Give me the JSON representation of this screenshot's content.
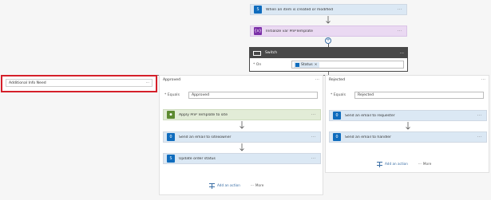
{
  "trigger": {
    "label": "When an item is created or modified"
  },
  "init_var": {
    "label": "Initialize var PnPTemplate",
    "icon_text": "{x}"
  },
  "switch_block": {
    "title": "Switch",
    "on_label": "* On",
    "on_token": "Status",
    "token_remove": "×"
  },
  "cases": {
    "additional": {
      "title": "Additional Info Need"
    },
    "approved": {
      "title": "Approved",
      "equals_label": "* Equals",
      "equals_value": "Approved",
      "steps": [
        "Apply PnP Template to site",
        "Send an email to sitexowner",
        "Update order status"
      ],
      "add_action": "Add an action",
      "more": "More"
    },
    "rejected": {
      "title": "Rejected",
      "equals_label": "* Equals",
      "equals_value": "Rejected",
      "steps": [
        "Send an email to requester",
        "Send an email to handler"
      ],
      "add_action": "Add an action",
      "more": "More"
    }
  },
  "menu_dots": "···",
  "more_dots": "···",
  "colors": {
    "trigger_bg": "#dbe8f4",
    "trigger_icon": "#0f6cbd",
    "var_bg": "#ead9f2",
    "var_icon": "#7b2fa8",
    "switch_head": "#484848",
    "green_bg": "#e2ecd7",
    "green_icon": "#5c8a2f",
    "highlight": "#d5202a"
  }
}
